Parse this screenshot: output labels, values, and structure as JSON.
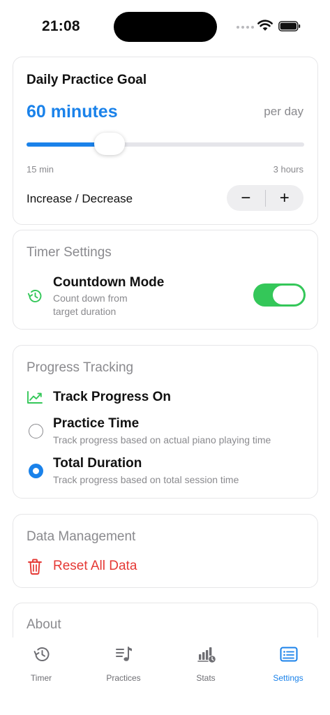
{
  "status_bar": {
    "time": "21:08"
  },
  "goal": {
    "title": "Daily Practice Goal",
    "value": "60 minutes",
    "unit": "per day",
    "range_min": "15 min",
    "range_max": "3 hours",
    "slider_fraction": 0.3,
    "stepper_label": "Increase / Decrease",
    "minus": "−",
    "plus": "+"
  },
  "timer": {
    "title": "Timer Settings",
    "countdown_title": "Countdown Mode",
    "countdown_sub_1": "Count down from",
    "countdown_sub_2": "target duration",
    "countdown_on": true
  },
  "progress": {
    "title": "Progress Tracking",
    "track_title": "Track Progress On",
    "options": [
      {
        "label": "Practice Time",
        "desc": "Track progress based on actual piano playing time",
        "selected": false
      },
      {
        "label": "Total Duration",
        "desc": "Track progress based on total session time",
        "selected": true
      }
    ]
  },
  "data": {
    "title": "Data Management",
    "reset": "Reset All Data"
  },
  "about": {
    "title": "About"
  },
  "tabs": [
    {
      "label": "Timer",
      "icon": "timer-history-icon",
      "active": false
    },
    {
      "label": "Practices",
      "icon": "music-list-icon",
      "active": false
    },
    {
      "label": "Stats",
      "icon": "stats-chart-icon",
      "active": false
    },
    {
      "label": "Settings",
      "icon": "settings-list-icon",
      "active": true
    }
  ],
  "colors": {
    "accent": "#1a82ea",
    "toggle_on": "#34c759",
    "destructive": "#e53935",
    "icon_green": "#34c759"
  }
}
